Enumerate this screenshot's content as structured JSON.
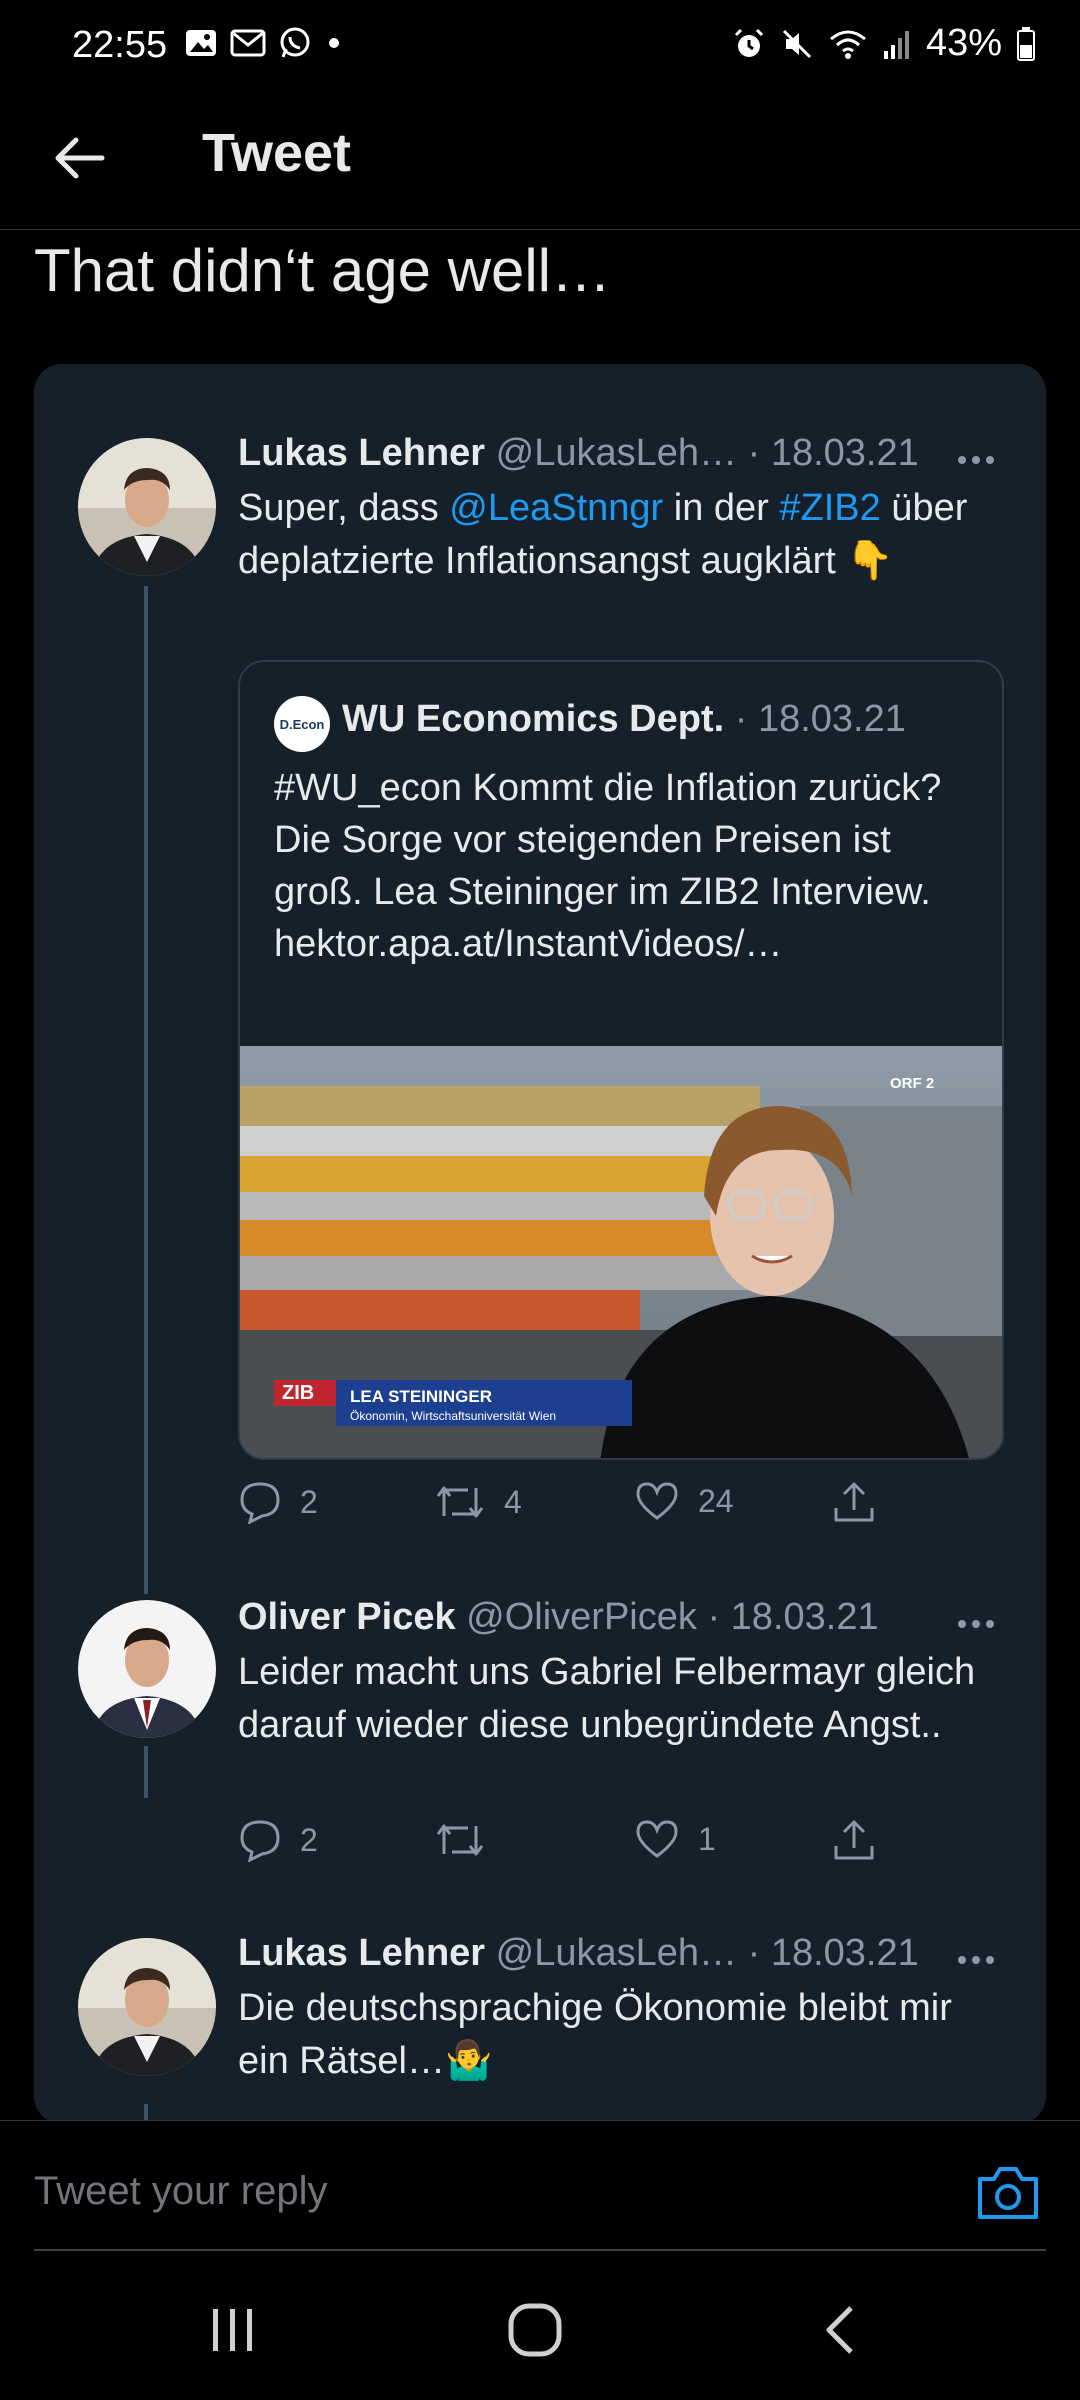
{
  "status": {
    "time": "22:55",
    "battery_pct": "43%",
    "left_icons": [
      "gallery-icon",
      "gmail-icon",
      "whatsapp-icon",
      "dot-icon"
    ],
    "right_icons": [
      "alarm-icon",
      "mute-icon",
      "wifi-icon",
      "signal-icon",
      "battery-icon"
    ]
  },
  "header": {
    "title": "Tweet"
  },
  "main_tweet": {
    "text": "That didn‘t age well…"
  },
  "thread": [
    {
      "name": "Lukas Lehner",
      "handle": "@LukasLeh…",
      "date": "18.03.21",
      "text_parts": [
        "Super, dass ",
        "@LeaStnngr",
        " in der ",
        "#ZIB2",
        " über deplatzierte Inflationsangst augklärt 👇"
      ],
      "quote": {
        "logo_text": "D.Econ",
        "name": "WU Economics Dept.",
        "date": "18.03.21",
        "text": "#WU_econ Kommt die Inflation zurück? Die Sorge vor steigenden Preisen ist groß. Lea Steininger im ZIB2 Interview. hektor.apa.at/InstantVideos/…",
        "media": {
          "zib_label": "ZIB",
          "lower_third_name": "LEA STEININGER",
          "lower_third_sub": "Ökonomin, Wirtschaftsuniversität Wien",
          "channel_logo": "ORF 2"
        }
      },
      "actions": {
        "replies": "2",
        "retweets": "4",
        "likes": "24"
      }
    },
    {
      "name": "Oliver Picek",
      "handle": "@OliverPicek",
      "date": "18.03.21",
      "text": "Leider macht uns Gabriel Felbermayr gleich darauf wieder diese unbegründete Angst..",
      "actions": {
        "replies": "2",
        "retweets": "",
        "likes": "1"
      }
    },
    {
      "name": "Lukas Lehner",
      "handle": "@LukasLeh…",
      "date": "18.03.21",
      "text": "Die deutschsprachige Ökonomie bleibt mir ein Rätsel…🤷‍♂️"
    }
  ],
  "reply": {
    "placeholder": "Tweet your reply"
  },
  "colors": {
    "background": "#000000",
    "card": "#15202b",
    "link": "#1d9bf0",
    "muted": "#8b98a5"
  }
}
